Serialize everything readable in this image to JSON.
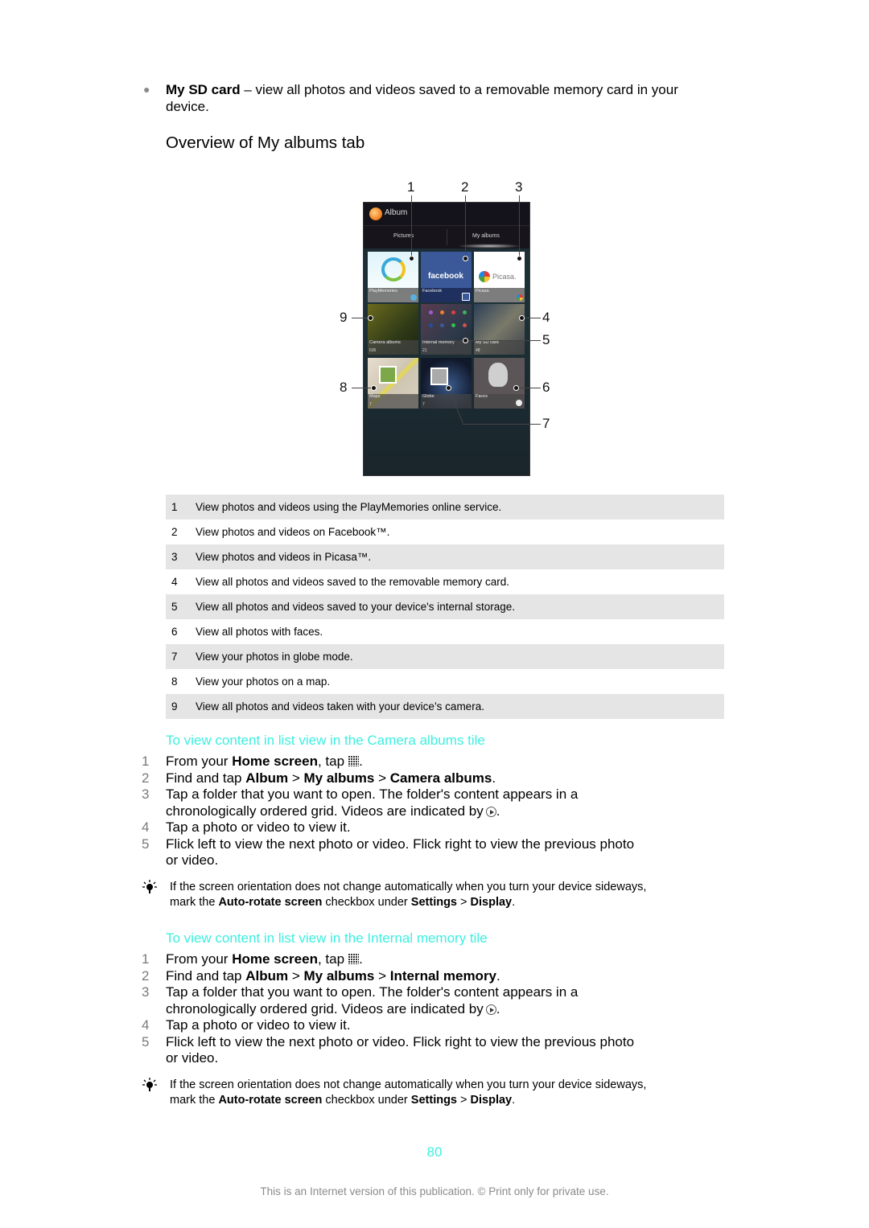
{
  "intro_bullet": {
    "term": "My SD card",
    "text_line1": " – view all photos and videos saved to a removable memory card in your",
    "text_line2": "device."
  },
  "section_title": "Overview of My albums tab",
  "figure": {
    "app_title": "Album",
    "tabs": [
      "Pictures",
      "My albums"
    ],
    "active_tab": "My albums",
    "tiles": [
      {
        "label": "PlayMemories",
        "count": ""
      },
      {
        "label": "Facebook",
        "count": ""
      },
      {
        "label": "Picasa",
        "count": ""
      },
      {
        "label": "Camera albums",
        "count": "635"
      },
      {
        "label": "Internal memory",
        "count": "21"
      },
      {
        "label": "My SD card",
        "count": "48"
      },
      {
        "label": "Maps",
        "count": "7"
      },
      {
        "label": "Globe",
        "count": "7"
      },
      {
        "label": "Faces",
        "count": ""
      }
    ],
    "facebook_logo_text": "facebook",
    "picasa_logo_text": "Picasa.",
    "callouts": [
      "1",
      "2",
      "3",
      "4",
      "5",
      "6",
      "7",
      "8",
      "9"
    ]
  },
  "legend": [
    {
      "num": "1",
      "text": "View photos and videos using the PlayMemories online service."
    },
    {
      "num": "2",
      "text": "View photos and videos on Facebook™."
    },
    {
      "num": "3",
      "text": "View photos and videos in Picasa™."
    },
    {
      "num": "4",
      "text": "View all photos and videos saved to the removable memory card."
    },
    {
      "num": "5",
      "text": "View all photos and videos saved to your device's internal storage."
    },
    {
      "num": "6",
      "text": "View all photos with faces."
    },
    {
      "num": "7",
      "text": "View your photos in globe mode."
    },
    {
      "num": "8",
      "text": "View your photos on a map."
    },
    {
      "num": "9",
      "text": "View all photos and videos taken with your device’s camera."
    }
  ],
  "procedures": [
    {
      "title": "To view content in list view in the Camera albums tile",
      "steps": {
        "s1": {
          "num": "1",
          "a": "From your ",
          "b": "Home screen",
          "c": ", tap",
          "d": "."
        },
        "s2": {
          "num": "2",
          "a": "Find and tap ",
          "b": "Album",
          "c": " > ",
          "d": "My albums",
          "e": " > ",
          "f": "Camera albums",
          "g": "."
        },
        "s3": {
          "num": "3",
          "line1": "Tap a folder that you want to open. The folder's content appears in a",
          "line2": "chronologically ordered grid. Videos are indicated by",
          "end": "."
        },
        "s4": {
          "num": "4",
          "text": "Tap a photo or video to view it."
        },
        "s5": {
          "num": "5",
          "line1": "Flick left to view the next photo or video. Flick right to view the previous photo",
          "line2": "or video."
        }
      },
      "tip": {
        "line1": "If the screen orientation does not change automatically when you turn your device sideways,",
        "a": "mark the ",
        "b": "Auto-rotate screen",
        "c": " checkbox under ",
        "d": "Settings",
        "e": " > ",
        "f": "Display",
        "g": "."
      }
    },
    {
      "title": "To view content in list view in the Internal memory tile",
      "steps": {
        "s1": {
          "num": "1",
          "a": "From your ",
          "b": "Home screen",
          "c": ", tap",
          "d": "."
        },
        "s2": {
          "num": "2",
          "a": "Find and tap ",
          "b": "Album",
          "c": " > ",
          "d": "My albums",
          "e": " > ",
          "f": "Internal memory",
          "g": "."
        },
        "s3": {
          "num": "3",
          "line1": "Tap a folder that you want to open. The folder's content appears in a",
          "line2": "chronologically ordered grid. Videos are indicated by",
          "end": "."
        },
        "s4": {
          "num": "4",
          "text": "Tap a photo or video to view it."
        },
        "s5": {
          "num": "5",
          "line1": "Flick left to view the next photo or video. Flick right to view the previous photo",
          "line2": "or video."
        }
      },
      "tip": {
        "line1": "If the screen orientation does not change automatically when you turn your device sideways,",
        "a": "mark the ",
        "b": "Auto-rotate screen",
        "c": " checkbox under ",
        "d": "Settings",
        "e": " > ",
        "f": "Display",
        "g": "."
      }
    }
  ],
  "page_number": "80",
  "footer": "This is an Internet version of this publication. © Print only for private use.",
  "colors": {
    "accent": "#3cf0e0",
    "legend_shade": "#e5e5e5"
  }
}
